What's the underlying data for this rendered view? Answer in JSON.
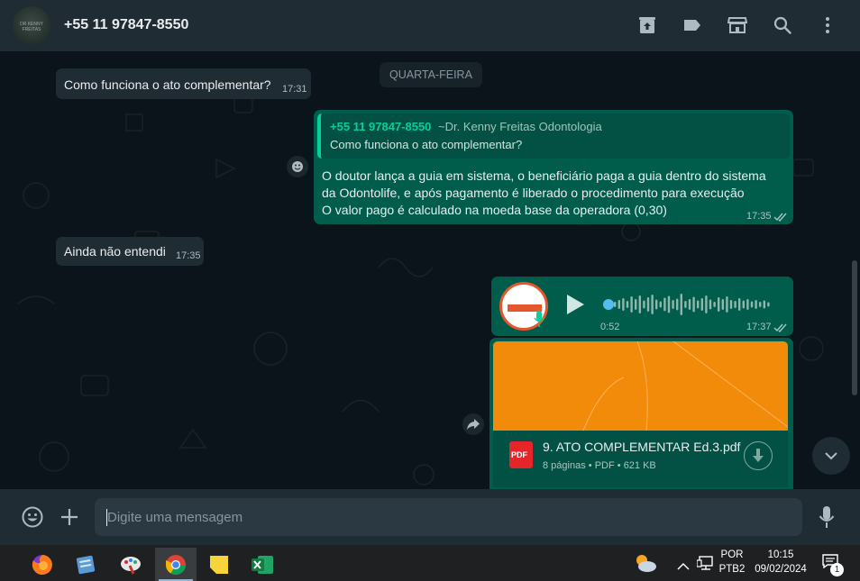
{
  "header": {
    "contact_name": "+55 11 97847-8550",
    "avatar_caption": "DR KENNY FREITAS"
  },
  "chat": {
    "day_label": "QUARTA-FEIRA",
    "messages": [
      {
        "dir": "in",
        "text": "Como funciona o ato complementar?",
        "time": "17:31"
      },
      {
        "dir": "out",
        "quote": {
          "name": "+55 11 97847-8550",
          "alt": "~Dr. Kenny Freitas Odontologia",
          "text": "Como funciona o ato complementar?"
        },
        "lines": [
          "O doutor lança a guia em sistema, o beneficiário paga a guia dentro do sistema",
          "da Odontolife, e após pagamento é liberado o procedimento para execução",
          "O valor pago é calculado na moeda base da operadora (0,30)"
        ],
        "time": "17:35"
      },
      {
        "dir": "in",
        "text": "Ainda não entendi",
        "time": "17:35"
      },
      {
        "dir": "out",
        "type": "audio",
        "duration": "0:52",
        "time": "17:37",
        "progress": 0
      },
      {
        "dir": "out",
        "type": "document",
        "filename": "9. ATO COMPLEMENTAR Ed.3.pdf",
        "file_badge": "PDF",
        "meta_pages": "8 páginas",
        "meta_type": "PDF",
        "meta_size": "621 KB"
      }
    ]
  },
  "compose": {
    "placeholder": "Digite uma mensagem"
  },
  "taskbar": {
    "lang_top": "POR",
    "lang_bottom": "PTB2",
    "clock_time": "10:15",
    "clock_date": "09/02/2024",
    "notification_count": "1"
  },
  "colors": {
    "header_bg": "#202c33",
    "chat_bg": "#0b141a",
    "incoming_bubble": "#202c33",
    "outgoing_bubble": "#005c4b",
    "accent_green": "#06cf9c",
    "pdf_red": "#e5252a",
    "doc_preview_orange": "#f28a0a"
  },
  "icons": {
    "header": [
      "archive-icon",
      "label-icon",
      "store-icon",
      "search-icon",
      "menu-dots-icon"
    ],
    "compose": [
      "emoji-icon",
      "attach-plus-icon",
      "microphone-icon"
    ],
    "taskbar": [
      "firefox-icon",
      "notepad-icon",
      "paint-icon",
      "chrome-icon",
      "sticky-notes-icon",
      "excel-icon",
      "weather-icon",
      "chevron-up-icon",
      "network-icon",
      "notification-icon"
    ]
  }
}
